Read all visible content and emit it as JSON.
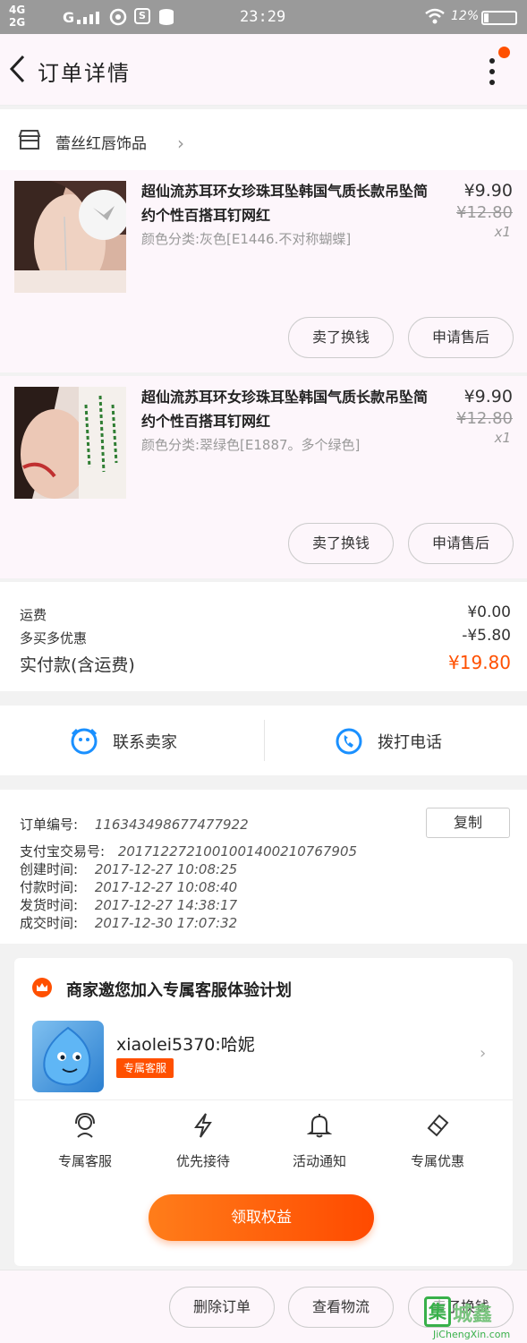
{
  "status_bar": {
    "network_top": "4G",
    "network_bottom": "2G",
    "network_g": "G",
    "time": "23:29",
    "battery": "12%"
  },
  "header": {
    "title": "订单详情"
  },
  "shop": {
    "name": "蕾丝红唇饰品"
  },
  "items": [
    {
      "name": "超仙流苏耳环女珍珠耳坠韩国气质长款吊坠简约个性百搭耳钉网红",
      "sku": "颜色分类:灰色[E1446.不对称蝴蝶]",
      "price": "¥9.90",
      "original_price": "¥12.80",
      "quantity": "x1",
      "btn_exchange": "卖了换钱",
      "btn_aftersale": "申请售后"
    },
    {
      "name": "超仙流苏耳环女珍珠耳坠韩国气质长款吊坠简约个性百搭耳钉网红",
      "sku": "颜色分类:翠绿色[E1887。多个绿色]",
      "price": "¥9.90",
      "original_price": "¥12.80",
      "quantity": "x1",
      "btn_exchange": "卖了换钱",
      "btn_aftersale": "申请售后"
    }
  ],
  "summary": {
    "shipping_label": "运费",
    "shipping_value": "¥0.00",
    "discount_label": "多买多优惠",
    "discount_value": "-¥5.80",
    "paid_label": "实付款(含运费)",
    "paid_value": "¥19.80"
  },
  "contact": {
    "seller": "联系卖家",
    "phone": "拨打电话"
  },
  "order_info": {
    "order_no_label": "订单编号:",
    "order_no": "116343498677477922",
    "copy_label": "复制",
    "alipay_label": "支付宝交易号:",
    "alipay_no": "2017122721001001400210767905",
    "created_label": "创建时间:",
    "created": "2017-12-27  10:08:25",
    "paid_label": "付款时间:",
    "paid": "2017-12-27  10:08:40",
    "shipped_label": "发货时间:",
    "shipped": "2017-12-27  14:38:17",
    "completed_label": "成交时间:",
    "completed": "2017-12-30  17:07:32"
  },
  "promo": {
    "title": "商家邀您加入专属客服体验计划",
    "service_name": "xiaolei5370:哈妮",
    "tag": "专属客服",
    "features": [
      "专属客服",
      "优先接待",
      "活动通知",
      "专属优惠"
    ],
    "cta": "领取权益"
  },
  "footer": {
    "delete_order": "删除订单",
    "view_logistics": "查看物流",
    "sell_exchange": "卖了换钱"
  },
  "watermark": {
    "logo": "集",
    "text": "城鑫",
    "url": "JiChengXin.com"
  },
  "colors": {
    "accent": "#ff5000",
    "background": "#f2f2f2",
    "card": "#fdf6fb"
  }
}
